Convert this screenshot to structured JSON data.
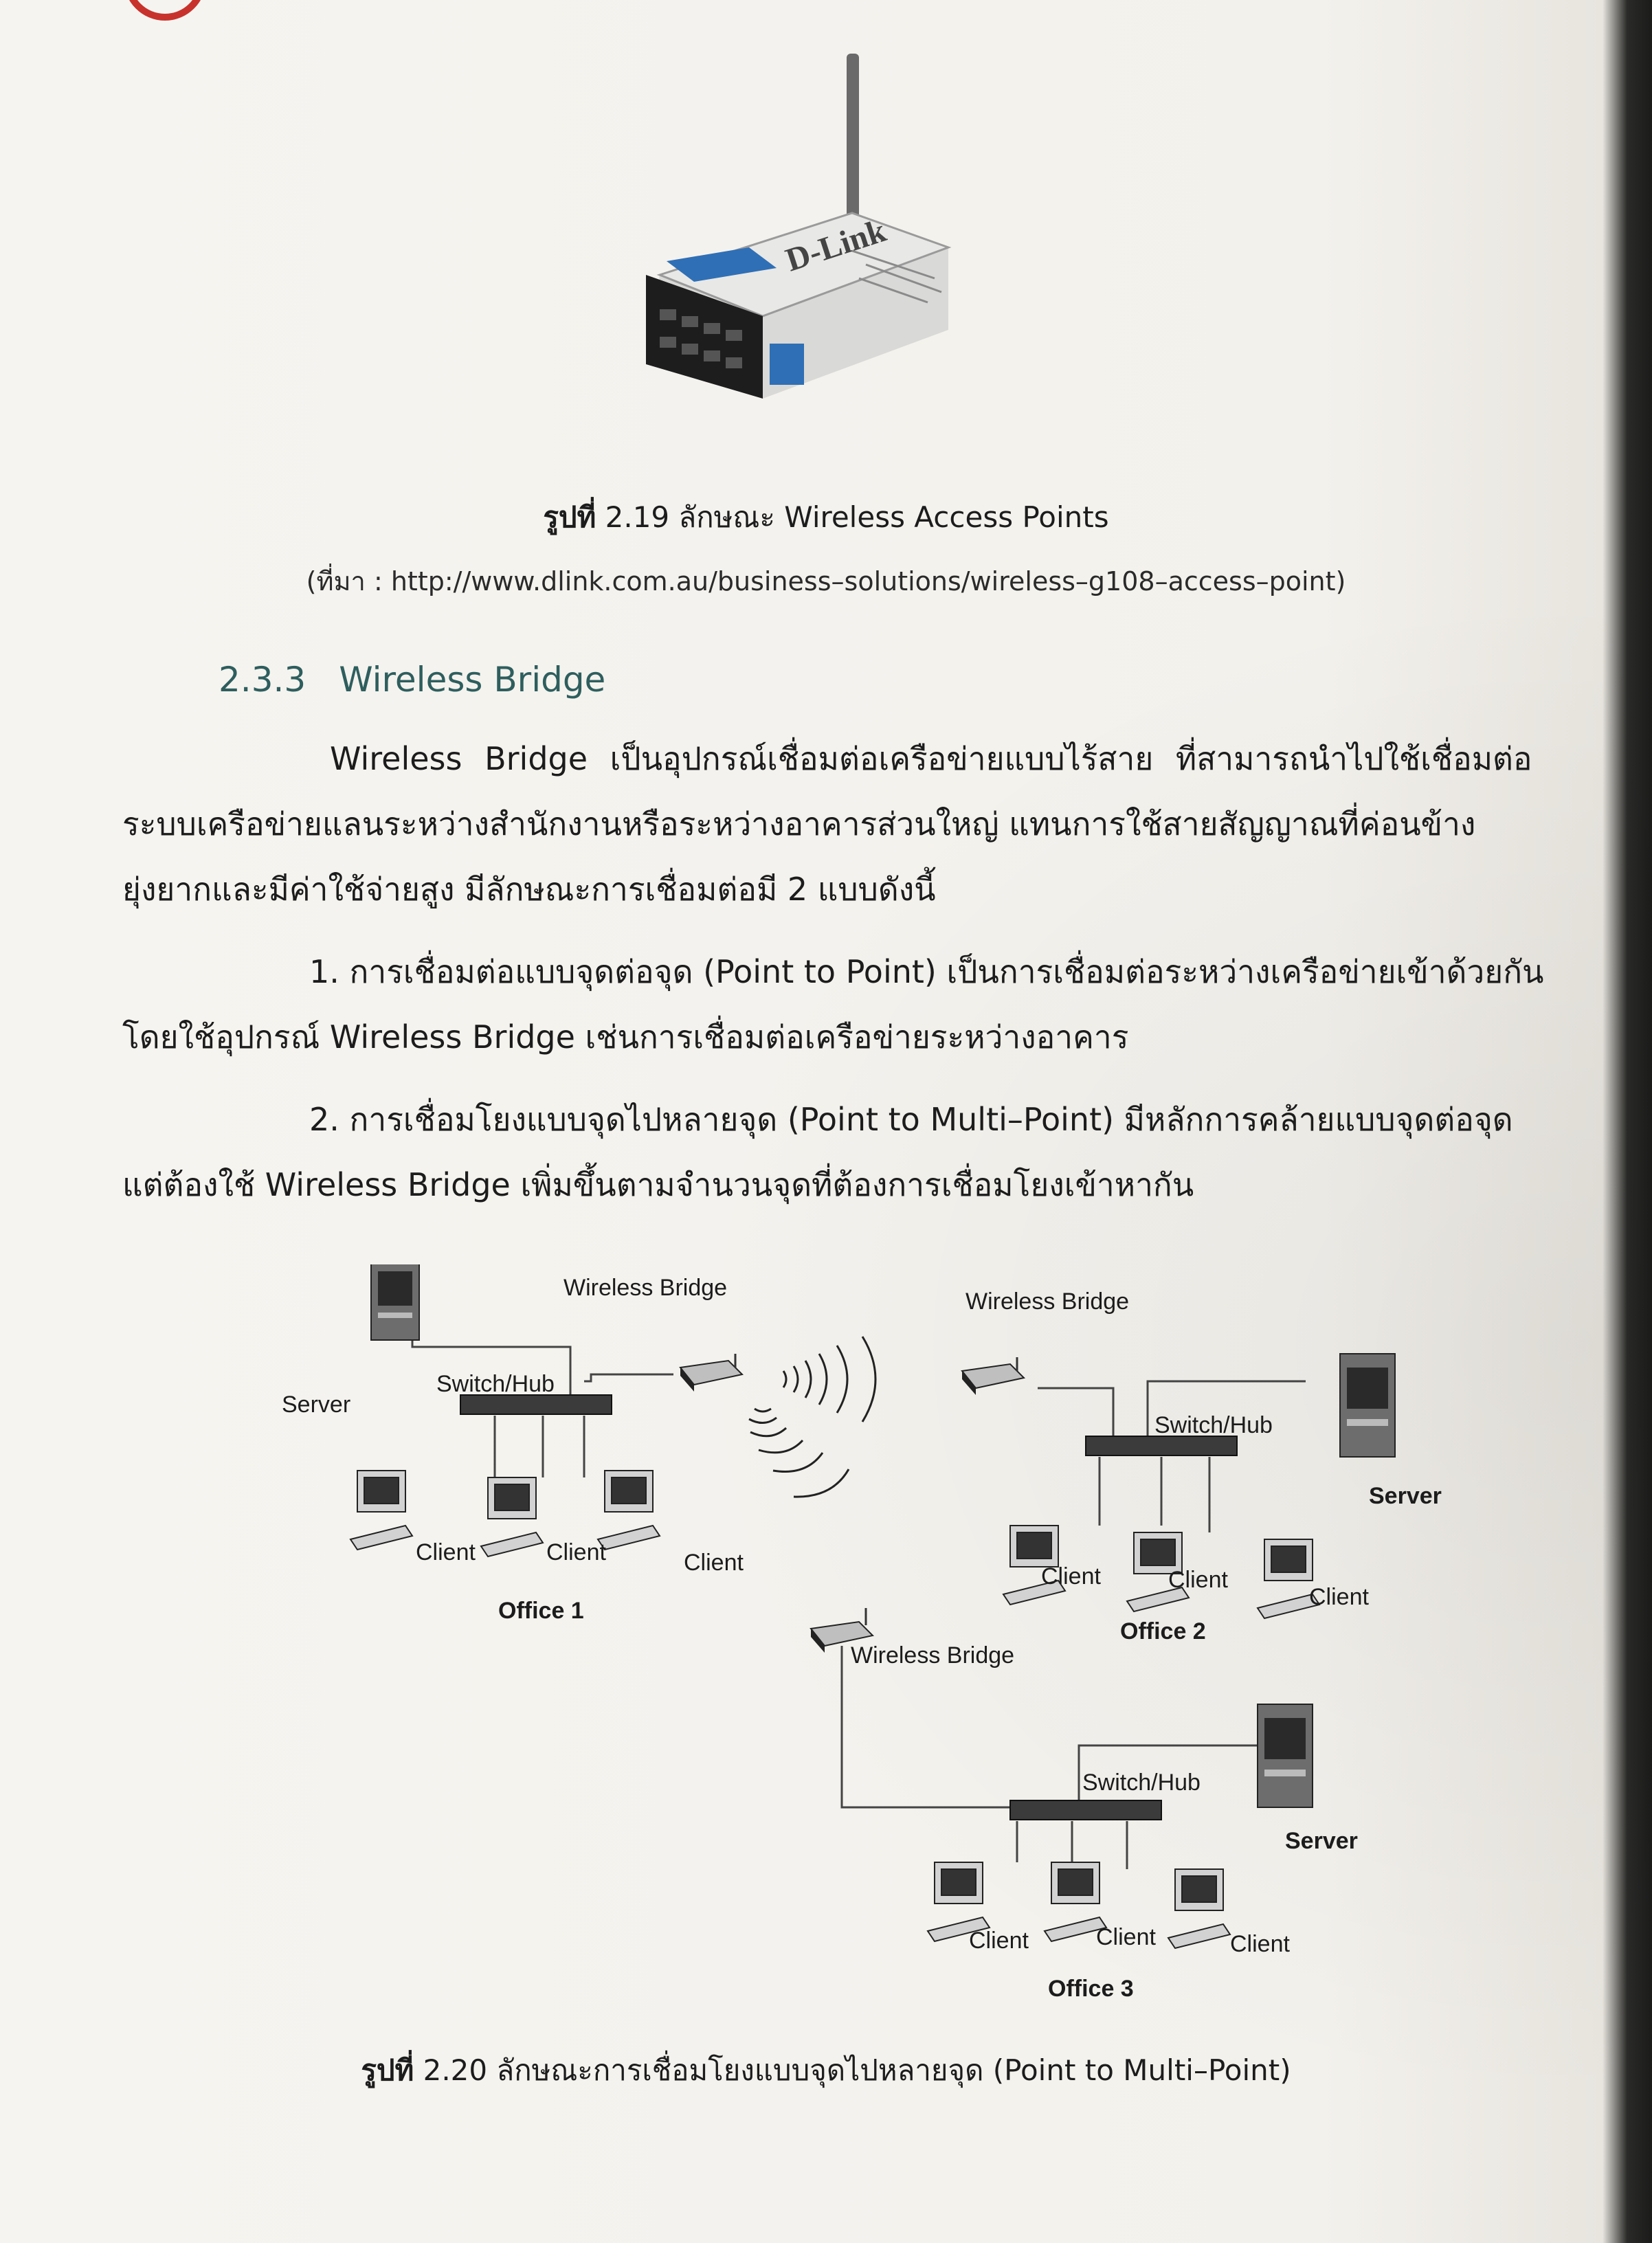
{
  "figure_1": {
    "brand_text": "D-Link",
    "caption_prefix": "รูปที่",
    "caption_text": " 2.19 ลักษณะ Wireless Access Points",
    "source": "(ที่มา : http://www.dlink.com.au/business–solutions/wireless–g108–access–point)"
  },
  "section": {
    "number": "2.3.3",
    "title": "Wireless Bridge"
  },
  "body": {
    "p1_l1": "Wireless Bridge เป็นอุปกรณ์เชื่อมต่อเครือข่ายแบบไร้สาย ที่สามารถนำไปใช้เชื่อมต่อ",
    "p1_l2": "ระบบเครือข่ายแลนระหว่างสำนักงานหรือระหว่างอาคารส่วนใหญ่ แทนการใช้สายสัญญาณที่ค่อนข้าง",
    "p1_l3": "ยุ่งยากและมีค่าใช้จ่ายสูง มีลักษณะการเชื่อมต่อมี 2 แบบดังนี้",
    "i1_l1": "1. การเชื่อมต่อแบบจุดต่อจุด (Point to Point) เป็นการเชื่อมต่อระหว่างเครือข่ายเข้าด้วยกัน",
    "i1_l2": "โดยใช้อุปกรณ์ Wireless Bridge เช่นการเชื่อมต่อเครือข่ายระหว่างอาคาร",
    "i2_l1": "2. การเชื่อมโยงแบบจุดไปหลายจุด (Point to Multi–Point) มีหลักการคล้ายแบบจุดต่อจุด",
    "i2_l2": "แต่ต้องใช้ Wireless Bridge เพิ่มขึ้นตามจำนวนจุดที่ต้องการเชื่อมโยงเข้าหากัน"
  },
  "diagram": {
    "wb1": "Wireless Bridge",
    "wb2": "Wireless Bridge",
    "wb3": "Wireless Bridge",
    "server1": "Server",
    "server2": "Server",
    "server3": "Server",
    "switch1": "Switch/Hub",
    "switch2": "Switch/Hub",
    "switch3": "Switch/Hub",
    "client": "Client",
    "office1": "Office 1",
    "office2": "Office 2",
    "office3": "Office 3"
  },
  "figure_2": {
    "caption_prefix": "รูปที่",
    "caption_text": " 2.20 ลักษณะการเชื่อมโยงแบบจุดไปหลายจุด (Point to Multi–Point)"
  }
}
